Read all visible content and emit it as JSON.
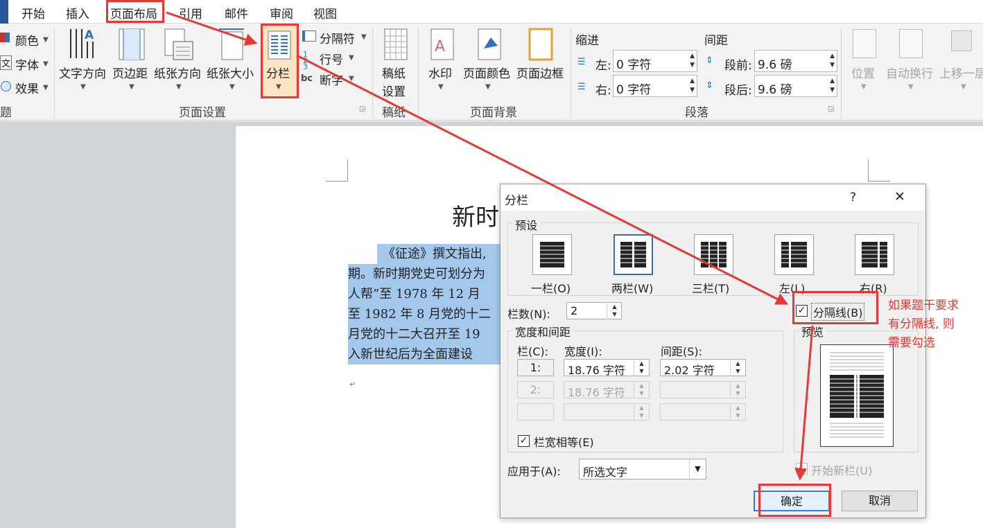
{
  "tabs": [
    "开始",
    "插入",
    "页面布局",
    "引用",
    "邮件",
    "审阅",
    "视图"
  ],
  "ribbon": {
    "theme_group": {
      "colors": "颜色",
      "fonts": "字体",
      "effects": "效果",
      "label": "题"
    },
    "page_setup": {
      "text_direction": "文字方向",
      "margins": "页边距",
      "orientation": "纸张方向",
      "size": "纸张大小",
      "columns": "分栏",
      "breaks": "分隔符",
      "line_numbers": "行号",
      "hyphenation": "断字",
      "label": "页面设置"
    },
    "draft": {
      "setting_line1": "稿纸",
      "setting_line2": "设置",
      "label": "稿纸"
    },
    "page_background": {
      "watermark": "水印",
      "page_color": "页面颜色",
      "page_borders": "页面边框",
      "label": "页面背景"
    },
    "paragraph": {
      "indent_title": "缩进",
      "left_label": "左:",
      "left_value": "0 字符",
      "right_label": "右:",
      "right_value": "0 字符",
      "spacing_title": "间距",
      "before_label": "段前:",
      "before_value": "9.6 磅",
      "after_label": "段后:",
      "after_value": "9.6 磅",
      "label": "段落"
    },
    "arrange": {
      "position": "位置",
      "wrap_text": "自动换行",
      "bring_forward": "上移一层"
    }
  },
  "document": {
    "title_partial": "新时",
    "lines": [
      "《征途》撰文指出,",
      "期。新时期党史可划分为",
      "人帮”至 1978 年 12 月",
      "至 1982 年 8 月党的十二",
      "月党的十二大召开至 19",
      "入新世纪后为全面建设"
    ],
    "para_mark": "↵"
  },
  "dialog": {
    "title": "分栏",
    "help": "?",
    "close": "✕",
    "presets_label": "预设",
    "presets": [
      "一栏(O)",
      "两栏(W)",
      "三栏(T)",
      "左(L)",
      "右(R)"
    ],
    "num_columns_label": "栏数(N):",
    "num_columns_value": "2",
    "separator_label": "分隔线(B)",
    "width_spacing_label": "宽度和间距",
    "col_header": "栏(C):",
    "width_header": "宽度(I):",
    "spacing_header": "间距(S):",
    "rows": [
      {
        "col": "1:",
        "width": "18.76 字符",
        "spacing": "2.02 字符"
      },
      {
        "col": "2:",
        "width": "18.76 字符",
        "spacing": ""
      },
      {
        "col": "",
        "width": "",
        "spacing": ""
      }
    ],
    "equal_width_label": "栏宽相等(E)",
    "preview_label": "预览",
    "apply_to_label": "应用于(A):",
    "apply_to_value": "所选文字",
    "new_column_label": "开始新栏(U)",
    "ok": "确定",
    "cancel": "取消"
  },
  "annotation": {
    "lines": [
      "如果题干要求",
      "有分隔线, 则",
      "需要勾选"
    ],
    "color": "#e53935"
  }
}
